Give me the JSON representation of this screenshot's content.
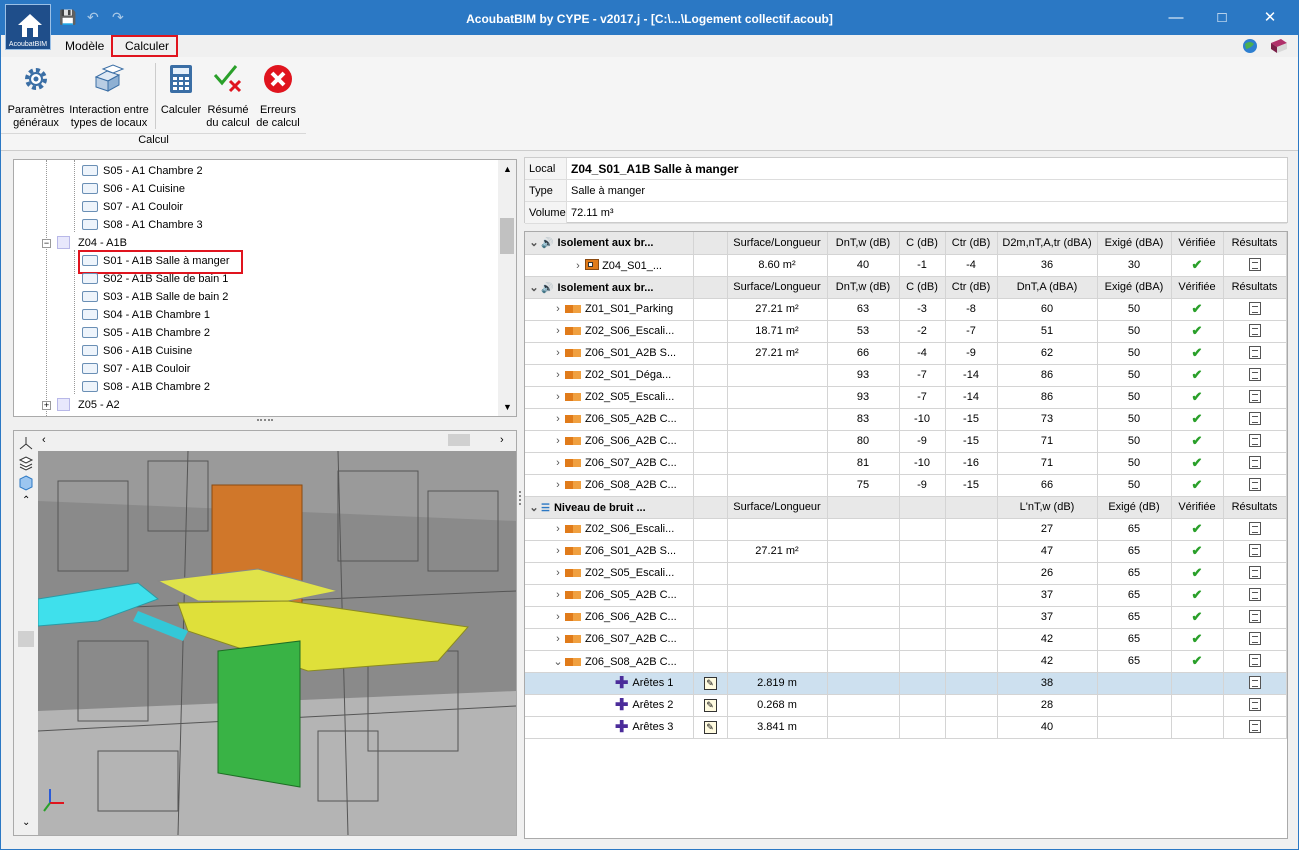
{
  "window": {
    "title": "AcoubatBIM by CYPE - v2017.j - [C:\\...\\Logement collectif.acoub]",
    "logo_text": "AcoubatBIM"
  },
  "menu": {
    "items": [
      "Modèle",
      "Calculer"
    ]
  },
  "ribbon": {
    "buttons": [
      {
        "l1": "Paramètres",
        "l2": "généraux"
      },
      {
        "l1": "Interaction entre",
        "l2": "types de locaux"
      },
      {
        "l1": "Calculer",
        "l2": ""
      },
      {
        "l1": "Résumé",
        "l2": "du calcul"
      },
      {
        "l1": "Erreurs",
        "l2": "de calcul"
      }
    ],
    "group_label": "Calcul"
  },
  "tree": {
    "nodes": [
      {
        "label": "S05 - A1 Chambre 2"
      },
      {
        "label": "S06 - A1 Cuisine"
      },
      {
        "label": "S07 - A1 Couloir"
      },
      {
        "label": "S08 - A1 Chambre 3"
      },
      {
        "label": "Z04 - A1B"
      },
      {
        "label": "S01 - A1B Salle à manger"
      },
      {
        "label": "S02 - A1B Salle de bain 1"
      },
      {
        "label": "S03 - A1B Salle de bain 2"
      },
      {
        "label": "S04 - A1B Chambre 1"
      },
      {
        "label": "S05 - A1B Chambre 2"
      },
      {
        "label": "S06 - A1B Cuisine"
      },
      {
        "label": "S07 - A1B Couloir"
      },
      {
        "label": "S08 - A1B Chambre 2"
      },
      {
        "label": "Z05 - A2"
      }
    ],
    "collapse_glyph": "−",
    "expand_glyph": "+"
  },
  "info": {
    "rows": [
      {
        "key": "Local",
        "value": "Z04_S01_A1B Salle à manger"
      },
      {
        "key": "Type",
        "value": "Salle à manger"
      },
      {
        "key": "Volume",
        "value": "72.11 m³"
      }
    ]
  },
  "colors": {
    "accent": "#2b78c4",
    "orange": "#e07b1a",
    "check": "#2aa02a",
    "highlight": "#e0141e"
  },
  "grid": {
    "sections": [
      {
        "title": "Isolement aux br...",
        "icon": "speaker-icon",
        "headers": [
          "Surface/Longueur",
          "DnT,w (dB)",
          "C (dB)",
          "Ctr (dB)",
          "D2m,nT,A,tr (dBA)",
          "Exigé (dBA)",
          "Vérifiée",
          "Résultats"
        ],
        "rows": [
          {
            "name": "Z04_S01_...",
            "icon": "orange-square",
            "v": [
              "8.60 m²",
              "40",
              "-1",
              "-4",
              "36",
              "30",
              "✔"
            ]
          }
        ]
      },
      {
        "title": "Isolement aux br...",
        "icon": "speaker-icon",
        "headers": [
          "Surface/Longueur",
          "DnT,w (dB)",
          "C (dB)",
          "Ctr (dB)",
          "DnT,A (dBA)",
          "Exigé (dBA)",
          "Vérifiée",
          "Résultats"
        ],
        "rows": [
          {
            "name": "Z01_S01_Parking",
            "v": [
              "27.21 m²",
              "63",
              "-3",
              "-8",
              "60",
              "50",
              "✔"
            ]
          },
          {
            "name": "Z02_S06_Escali...",
            "v": [
              "18.71 m²",
              "53",
              "-2",
              "-7",
              "51",
              "50",
              "✔"
            ]
          },
          {
            "name": "Z06_S01_A2B S...",
            "v": [
              "27.21 m²",
              "66",
              "-4",
              "-9",
              "62",
              "50",
              "✔"
            ]
          },
          {
            "name": "Z02_S01_Déga...",
            "v": [
              "",
              "93",
              "-7",
              "-14",
              "86",
              "50",
              "✔"
            ]
          },
          {
            "name": "Z02_S05_Escali...",
            "v": [
              "",
              "93",
              "-7",
              "-14",
              "86",
              "50",
              "✔"
            ]
          },
          {
            "name": "Z06_S05_A2B C...",
            "v": [
              "",
              "83",
              "-10",
              "-15",
              "73",
              "50",
              "✔"
            ]
          },
          {
            "name": "Z06_S06_A2B C...",
            "v": [
              "",
              "80",
              "-9",
              "-15",
              "71",
              "50",
              "✔"
            ]
          },
          {
            "name": "Z06_S07_A2B C...",
            "v": [
              "",
              "81",
              "-10",
              "-16",
              "71",
              "50",
              "✔"
            ]
          },
          {
            "name": "Z06_S08_A2B C...",
            "v": [
              "",
              "75",
              "-9",
              "-15",
              "66",
              "50",
              "✔"
            ]
          }
        ]
      },
      {
        "title": "Niveau de bruit ...",
        "icon": "impact-icon",
        "headers": [
          "Surface/Longueur",
          "",
          "",
          "",
          "L'nT,w (dB)",
          "Exigé (dB)",
          "Vérifiée",
          "Résultats"
        ],
        "rows": [
          {
            "name": "Z02_S06_Escali...",
            "v": [
              "",
              "",
              "",
              "",
              "27",
              "65",
              "✔"
            ]
          },
          {
            "name": "Z06_S01_A2B S...",
            "v": [
              "27.21 m²",
              "",
              "",
              "",
              "47",
              "65",
              "✔"
            ]
          },
          {
            "name": "Z02_S05_Escali...",
            "v": [
              "",
              "",
              "",
              "",
              "26",
              "65",
              "✔"
            ]
          },
          {
            "name": "Z06_S05_A2B C...",
            "v": [
              "",
              "",
              "",
              "",
              "37",
              "65",
              "✔"
            ]
          },
          {
            "name": "Z06_S06_A2B C...",
            "v": [
              "",
              "",
              "",
              "",
              "37",
              "65",
              "✔"
            ]
          },
          {
            "name": "Z06_S07_A2B C...",
            "v": [
              "",
              "",
              "",
              "",
              "42",
              "65",
              "✔"
            ]
          },
          {
            "name": "Z06_S08_A2B C...",
            "v": [
              "",
              "",
              "",
              "",
              "42",
              "65",
              "✔"
            ]
          }
        ]
      }
    ],
    "sub_rows": [
      {
        "name": "Arêtes 1",
        "length": "2.819 m",
        "value": "38"
      },
      {
        "name": "Arêtes 2",
        "length": "0.268 m",
        "value": "28"
      },
      {
        "name": "Arêtes 3",
        "length": "3.841 m",
        "value": "40"
      }
    ]
  }
}
